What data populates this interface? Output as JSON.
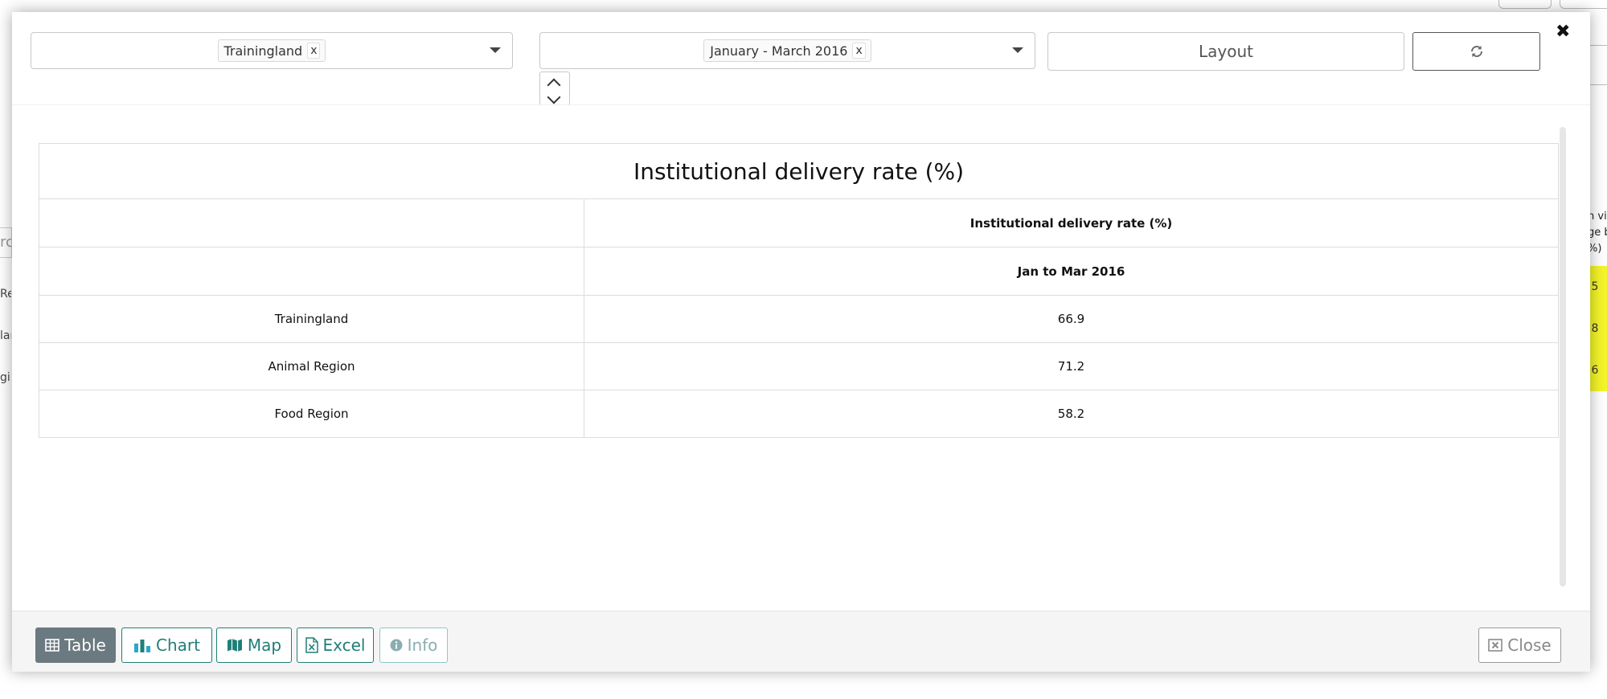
{
  "filters": {
    "org_unit": {
      "tag": "Trainingland",
      "remove": "x"
    },
    "period": {
      "tag": "January - March 2016",
      "remove": "x"
    },
    "layout_label": "Layout"
  },
  "modal": {
    "close_symbol": "✖"
  },
  "report": {
    "title": "Institutional delivery rate (%)",
    "column_header": "Institutional delivery rate (%)",
    "period_header": "Jan to Mar 2016",
    "rows": [
      {
        "label": "Trainingland",
        "value": "66.9"
      },
      {
        "label": "Animal Region",
        "value": "71.2"
      },
      {
        "label": "Food Region",
        "value": "58.2"
      }
    ]
  },
  "footer": {
    "table": "Table",
    "chart": "Chart",
    "map": "Map",
    "excel": "Excel",
    "info": "Info",
    "close": "Close"
  },
  "background": {
    "right_lines": [
      "n vi",
      "ge b",
      "%)"
    ],
    "right_values": [
      ".5",
      ".8",
      ".6"
    ],
    "left_labels": [
      "Re",
      "lar",
      "gi"
    ],
    "left_input": "rc"
  },
  "colors": {
    "teal": "#1f7f78",
    "active_tab": "#6b7a80",
    "highlight_yellow": "#f5f52a",
    "chart_icon": "#2aa7c9"
  }
}
